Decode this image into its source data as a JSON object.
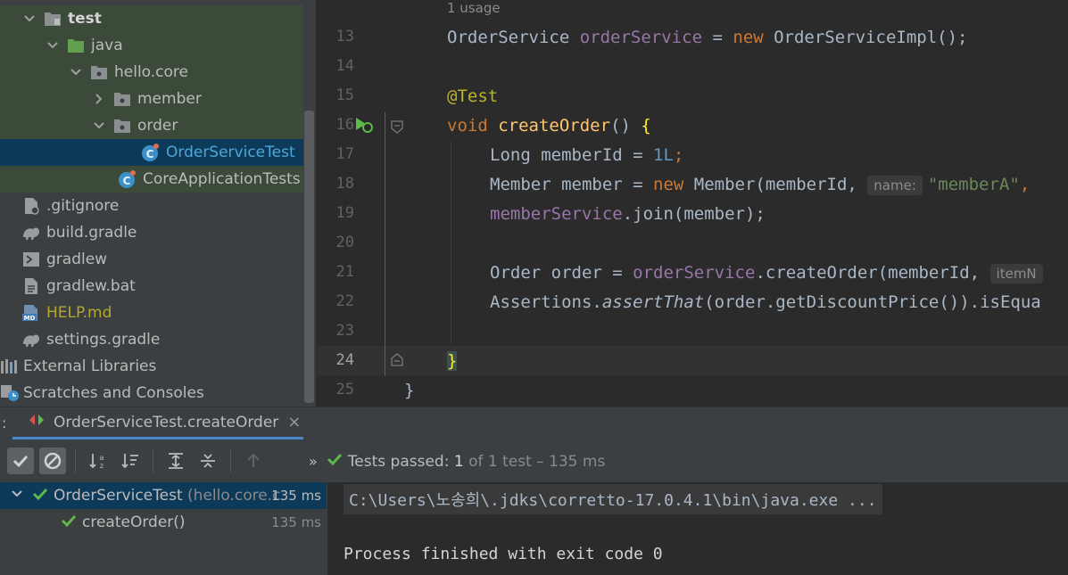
{
  "project_tree": {
    "items": [
      {
        "label": "test",
        "icon": "test-folder-icon",
        "expanded": true
      },
      {
        "label": "java",
        "icon": "folder-icon",
        "expanded": true
      },
      {
        "label": "hello.core",
        "icon": "package-icon",
        "expanded": true
      },
      {
        "label": "member",
        "icon": "package-icon",
        "expanded": false
      },
      {
        "label": "order",
        "icon": "package-icon",
        "expanded": true
      },
      {
        "label": "OrderServiceTest",
        "icon": "java-class-icon"
      },
      {
        "label": "CoreApplicationTests",
        "icon": "java-class-icon"
      },
      {
        "label": ".gitignore",
        "icon": "file-icon"
      },
      {
        "label": "build.gradle",
        "icon": "gradle-icon"
      },
      {
        "label": "gradlew",
        "icon": "terminal-icon"
      },
      {
        "label": "gradlew.bat",
        "icon": "file-icon"
      },
      {
        "label": "HELP.md",
        "icon": "markdown-icon"
      },
      {
        "label": "settings.gradle",
        "icon": "gradle-icon"
      },
      {
        "label": "External Libraries",
        "icon": "library-icon"
      },
      {
        "label": "Scratches and Consoles",
        "icon": "scratches-icon"
      }
    ]
  },
  "editor": {
    "usage_hint": "1 usage",
    "line_numbers": [
      "13",
      "14",
      "15",
      "16",
      "17",
      "18",
      "19",
      "20",
      "21",
      "22",
      "23",
      "24",
      "25"
    ],
    "hints": {
      "name": "name:",
      "item": "itemN"
    },
    "code": {
      "l13": {
        "type": "OrderService",
        "field": "orderService",
        "eq": " = ",
        "new": "new",
        "ctor": " OrderServiceImpl();"
      },
      "l15": {
        "ann": "@Test"
      },
      "l16": {
        "void": "void",
        "fn": "createOrder",
        "rest": "() ",
        "brace": "{"
      },
      "l17": {
        "a": "Long memberId = ",
        "num": "1L",
        "semi": ";"
      },
      "l18": {
        "a": "Member member = ",
        "new": "new",
        "b": " Member(memberId, ",
        "str": "\"memberA\"",
        "c": ","
      },
      "l19": {
        "field": "memberService",
        "rest": ".join(member);"
      },
      "l21": {
        "a": "Order order = ",
        "field": "orderService",
        "rest": ".createOrder(memberId, "
      },
      "l22": {
        "a": "Assertions.",
        "ital": "assertThat",
        "rest": "(order.getDiscountPrice()).isEqua"
      },
      "l24": {
        "brace": "}"
      },
      "l25": {
        "brace": "}"
      }
    }
  },
  "run_panel": {
    "tab_label": "OrderServiceTest.createOrder",
    "close": "×",
    "more": "»",
    "status": {
      "passed": "Tests passed:",
      "count": "1",
      "rest": "of 1 test – 135 ms"
    },
    "results": [
      {
        "name": "OrderServiceTest",
        "detail": "(hello.core.c",
        "time": "135 ms"
      },
      {
        "name": "createOrder()",
        "time": "135 ms"
      }
    ],
    "console": {
      "command": "C:\\Users\\노송희\\.jdks\\corretto-17.0.4.1\\bin\\java.exe ...",
      "exit": "Process finished with exit code 0"
    }
  },
  "colors": {
    "pass": "#5fb84a",
    "selection": "#0e3a5a",
    "accent": "#4a88c7"
  }
}
